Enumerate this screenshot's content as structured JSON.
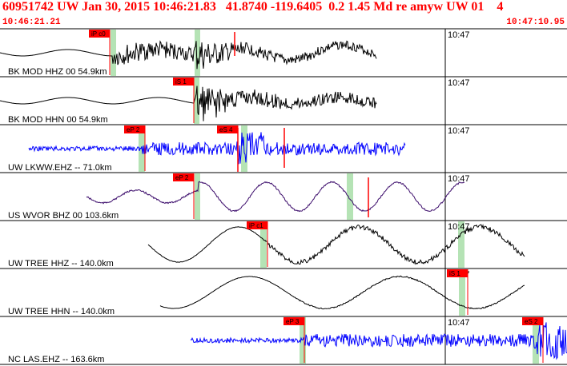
{
  "header": {
    "title": "60951742 UW Jan 30, 2015 10:46:21.83   41.8740 -119.6405  0.2 1.45 Md re amyw UW 01    4",
    "start_time": "10:46:21.21",
    "end_time": "10:47:10.95"
  },
  "colors": {
    "title": "#ff0000",
    "pick_box": "#ff0000",
    "pick_window": "#b5e3b5",
    "trace_black": "#000000",
    "trace_blue": "#0000ff",
    "trace_purple": "#3a0a6a"
  },
  "traces": [
    {
      "label": "BK MOD HHZ 00 54.9km",
      "tick_label": "10:47",
      "color": "black",
      "picks": [
        {
          "label": "iP c0"
        }
      ]
    },
    {
      "label": "BK MOD HHN 00 54.9km",
      "tick_label": "10:47",
      "color": "black",
      "picks": [
        {
          "label": "iS 1"
        }
      ]
    },
    {
      "label": "UW LKWW.EHZ -- 71.0km",
      "tick_label": "10:47",
      "color": "blue",
      "picks": [
        {
          "label": "eP 2"
        },
        {
          "label": "eS 4"
        }
      ]
    },
    {
      "label": "US WVOR BHZ 00 103.6km",
      "tick_label": "10:47",
      "color": "purple",
      "picks": [
        {
          "label": "eP 2"
        }
      ]
    },
    {
      "label": "UW TREE HHZ -- 140.0km",
      "tick_label": "10:47",
      "color": "black",
      "picks": [
        {
          "label": "iP c1"
        }
      ]
    },
    {
      "label": "UW TREE HHN -- 140.0km",
      "tick_label": "10:47",
      "color": "black",
      "picks": [
        {
          "label": "iS 1"
        }
      ]
    },
    {
      "label": "NC LAS.EHZ -- 163.6km",
      "tick_label": "10:47",
      "color": "blue",
      "picks": [
        {
          "label": "eP 3"
        },
        {
          "label": "eS 2"
        }
      ]
    }
  ]
}
